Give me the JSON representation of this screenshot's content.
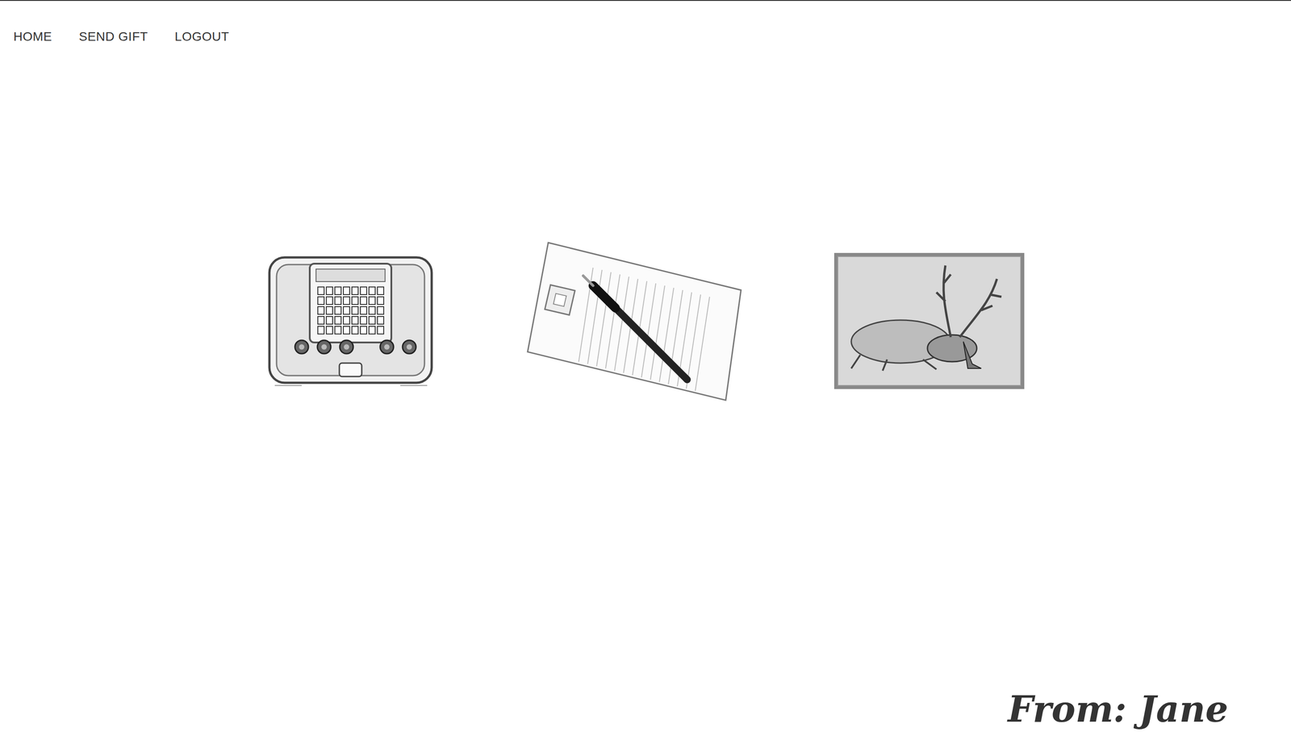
{
  "nav": [
    {
      "label": "HOME"
    },
    {
      "label": "SEND GIFT"
    },
    {
      "label": "LOGOUT"
    }
  ],
  "signature": "From: Jane"
}
